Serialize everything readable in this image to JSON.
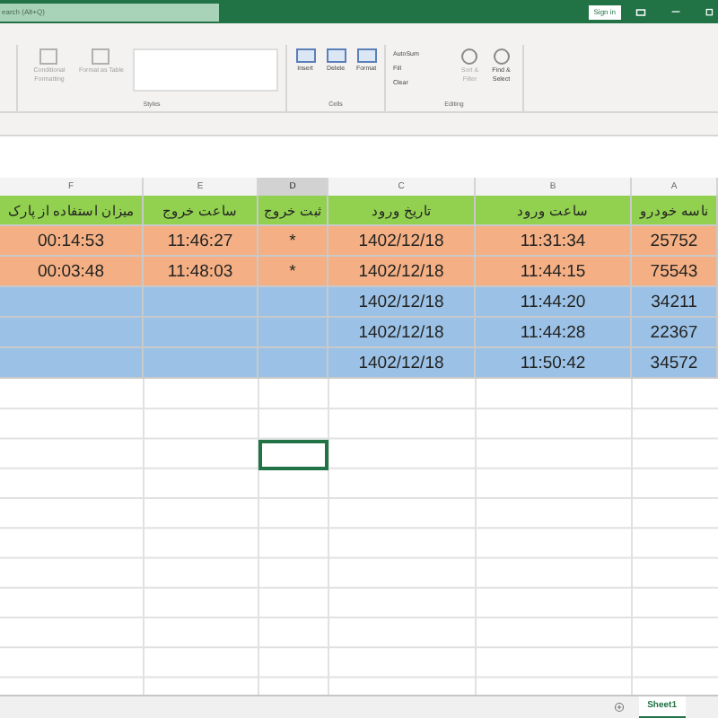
{
  "title_bar": {
    "search_placeholder": "earch (Alt+Q)",
    "sign_in": "Sign in"
  },
  "ribbon": {
    "styles": {
      "buttons": [
        "Conditional Formatting",
        "Format as Table"
      ],
      "label": "Styles"
    },
    "cells": {
      "buttons": [
        "Insert",
        "Delete",
        "Format"
      ],
      "label": "Cells"
    },
    "editing": {
      "small_buttons": [
        "AutoSum",
        "Fill",
        "Clear"
      ],
      "buttons": [
        "Sort & Filter",
        "Find & Select"
      ],
      "label": "Editing"
    }
  },
  "sheet": {
    "columns": [
      {
        "letter": "F",
        "selected": false
      },
      {
        "letter": "E",
        "selected": false
      },
      {
        "letter": "D",
        "selected": true
      },
      {
        "letter": "C",
        "selected": false
      },
      {
        "letter": "B",
        "selected": false
      },
      {
        "letter": "A",
        "selected": false
      }
    ],
    "rows": [
      {
        "color": "#92d050",
        "cells": [
          "میزان استفاده از پارک",
          "ساعت خروج",
          "ثبت خروج",
          "تاریخ ورود",
          "ساعت ورود",
          "ناسه خودرو"
        ]
      },
      {
        "color": "#f4b084",
        "cells": [
          "00:14:53",
          "11:46:27",
          "*",
          "1402/12/18",
          "11:31:34",
          "25752"
        ]
      },
      {
        "color": "#f4b084",
        "cells": [
          "00:03:48",
          "11:48:03",
          "*",
          "1402/12/18",
          "11:44:15",
          "75543"
        ]
      },
      {
        "color": "#9bc2e6",
        "cells": [
          "",
          "",
          "",
          "1402/12/18",
          "11:44:20",
          "34211"
        ]
      },
      {
        "color": "#9bc2e6",
        "cells": [
          "",
          "",
          "",
          "1402/12/18",
          "11:44:28",
          "22367"
        ]
      },
      {
        "color": "#9bc2e6",
        "cells": [
          "",
          "",
          "",
          "1402/12/18",
          "11:50:42",
          "34572"
        ]
      }
    ],
    "tabs": [
      {
        "label": "Sheet1",
        "selected": true
      }
    ]
  }
}
